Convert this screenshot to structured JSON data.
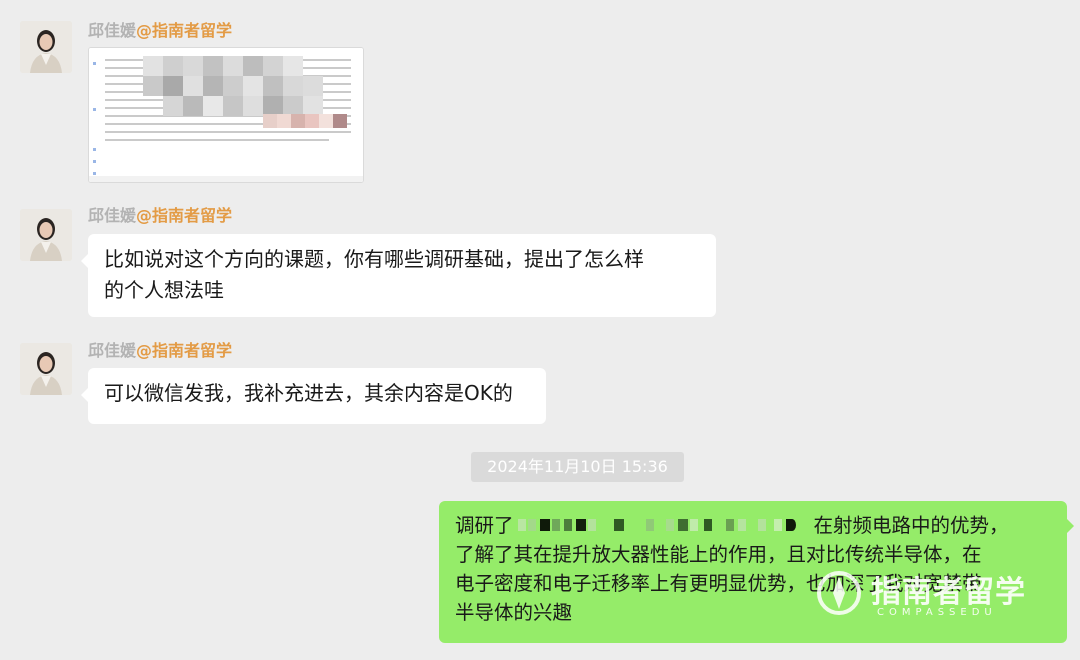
{
  "messages": [
    {
      "sender_name": "邱佳媛",
      "sender_org": "@指南者留学",
      "type": "image"
    },
    {
      "sender_name": "邱佳媛",
      "sender_org": "@指南者留学",
      "type": "text",
      "lines": [
        "比如说对这个方向的课题，你有哪些调研基础，提出了怎么样",
        "的个人想法哇"
      ]
    },
    {
      "sender_name": "邱佳媛",
      "sender_org": "@指南者留学",
      "type": "text",
      "lines": [
        "可以微信发我，我补充进去，其余内容是OK的"
      ]
    }
  ],
  "timestamp": "2024年11月10日 15:36",
  "reply": {
    "line1_start": "调研了",
    "line1_end": "在射频电路中的优势，",
    "line2": "了解了其在提升放大器性能上的作用，且对比传统半导体，在",
    "line3": "电子密度和电子迁移率上有更明显优势，也加深了我对宽禁带",
    "line4": "半导体的兴趣"
  },
  "watermark": {
    "brand": "指南者留学",
    "sub": "COMPASSEDU"
  },
  "colors": {
    "background": "#ededed",
    "incoming_bubble": "#ffffff",
    "outgoing_bubble": "#95ec69",
    "org_text": "#e39b45"
  }
}
